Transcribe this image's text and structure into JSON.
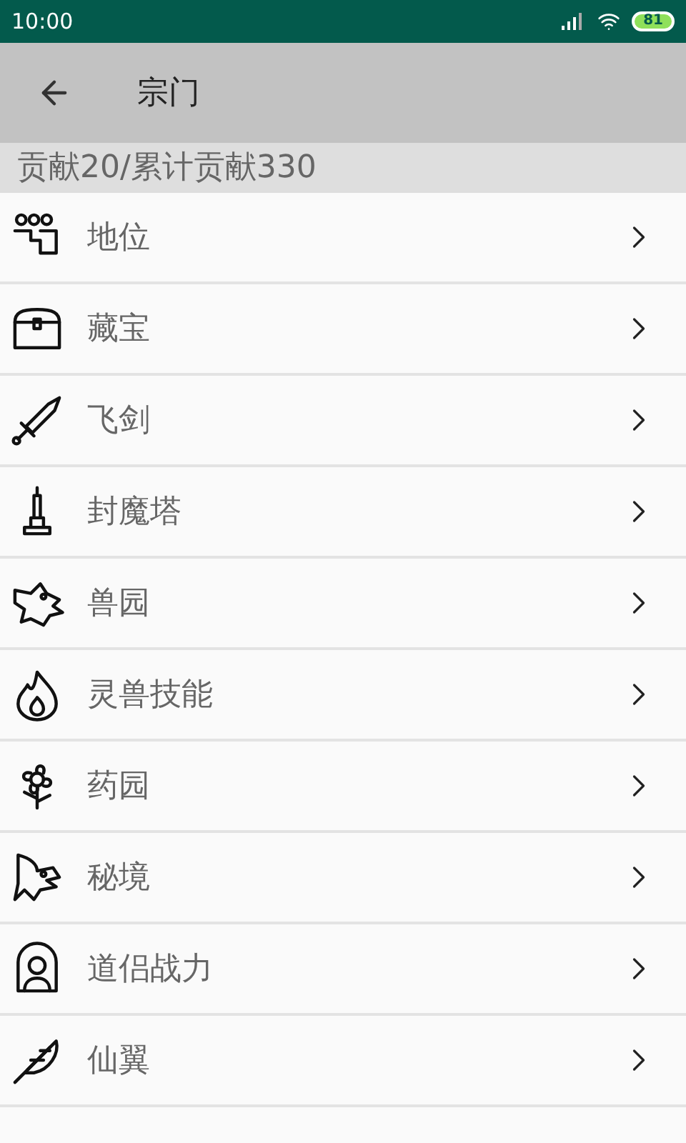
{
  "status_bar": {
    "time": "10:00",
    "battery": "81"
  },
  "header": {
    "title": "宗门"
  },
  "contribution": "贡献20/累计贡献330",
  "items": [
    {
      "label": "地位"
    },
    {
      "label": "藏宝"
    },
    {
      "label": "飞剑"
    },
    {
      "label": "封魔塔"
    },
    {
      "label": "兽园"
    },
    {
      "label": "灵兽技能"
    },
    {
      "label": "药园"
    },
    {
      "label": "秘境"
    },
    {
      "label": "道侣战力"
    },
    {
      "label": "仙翼"
    }
  ]
}
